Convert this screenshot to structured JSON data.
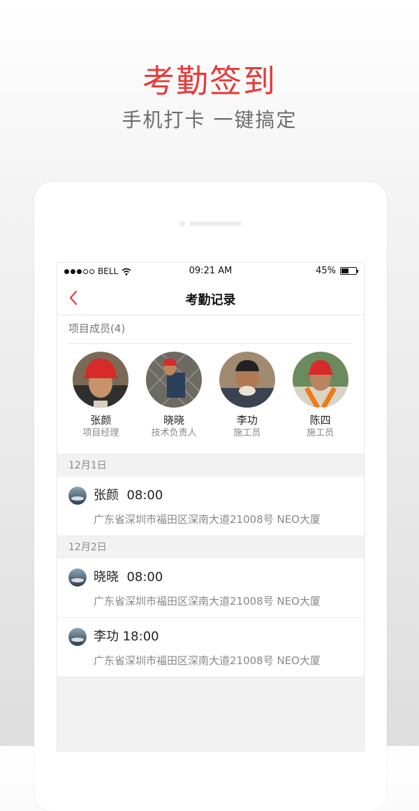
{
  "promo": {
    "title": "考勤签到",
    "subtitle": "手机打卡 一键搞定"
  },
  "status_bar": {
    "carrier": "BELL",
    "time": "09:21 AM",
    "battery": "45%",
    "battery_level": 0.45
  },
  "nav": {
    "title": "考勤记录",
    "back_icon": "chevron-left-icon"
  },
  "members": {
    "header": "项目成员(4)",
    "list": [
      {
        "name": "张颜",
        "role": "项目经理"
      },
      {
        "name": "晓晓",
        "role": "技术负责人"
      },
      {
        "name": "李功",
        "role": "施工员"
      },
      {
        "name": "陈四",
        "role": "施工员"
      }
    ]
  },
  "records": [
    {
      "date": "12月1日",
      "entries": [
        {
          "name": "张颜",
          "time": "08:00",
          "address": "广东省深圳市福田区深南大道21008号 NEO大厦"
        }
      ]
    },
    {
      "date": "12月2日",
      "entries": [
        {
          "name": "晓晓",
          "time": "08:00",
          "address": "广东省深圳市福田区深南大道21008号 NEO大厦"
        },
        {
          "name": "李功",
          "time": "18:00",
          "address": "广东省深圳市福田区深南大道21008号 NEO大厦"
        }
      ]
    }
  ],
  "colors": {
    "accent": "#e83a3a",
    "helmet": "#d92a2a",
    "background": "#f2f2f2"
  }
}
